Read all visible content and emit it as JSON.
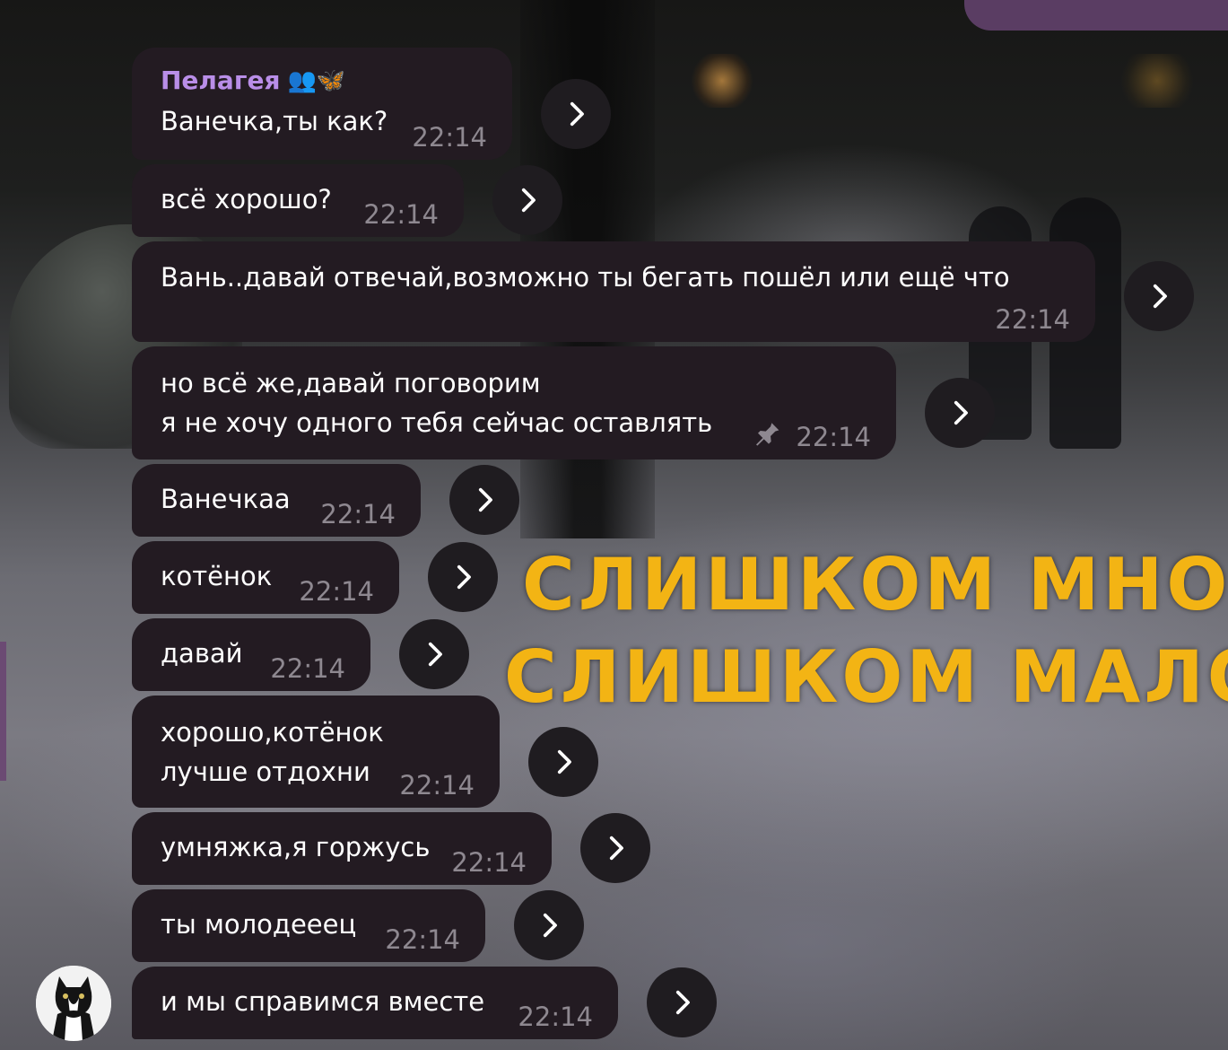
{
  "chat": {
    "sender_name": "Пелагея",
    "sender_emoji": "👥🦋",
    "overlay_line1": "СЛИШКОМ МНОГО С",
    "overlay_line2": "СЛИШКОМ МАЛО СМ",
    "messages": [
      {
        "text": "Ванечка,ты как?",
        "time": "22:14"
      },
      {
        "text": "всё хорошо?",
        "time": "22:14"
      },
      {
        "text": "Вань..давай отвечай,возможно ты бегать пошёл или ещё что",
        "time": "22:14"
      },
      {
        "text": "но всё же,давай поговорим\nя не хочу одного тебя сейчас оставлять",
        "time": "22:14",
        "pinned": true
      },
      {
        "text": "Ванечкаа",
        "time": "22:14"
      },
      {
        "text": "котёнок",
        "time": "22:14"
      },
      {
        "text": "давай",
        "time": "22:14"
      },
      {
        "text": "хорошо,котёнок\nлучше отдохни",
        "time": "22:14"
      },
      {
        "text": "умняжка,я горжусь",
        "time": "22:14"
      },
      {
        "text": "ты молодееец",
        "time": "22:14"
      },
      {
        "text": "и мы справимся вместе",
        "time": "22:14"
      }
    ]
  },
  "colors": {
    "bubble_bg": "#231b22",
    "sender_color": "#b98ee8",
    "time_color": "#8e8890",
    "accent_purple": "#5a3d63"
  },
  "icons": {
    "forward": "chevron-right-icon",
    "pin": "pin-icon",
    "avatar": "cat-avatar"
  }
}
